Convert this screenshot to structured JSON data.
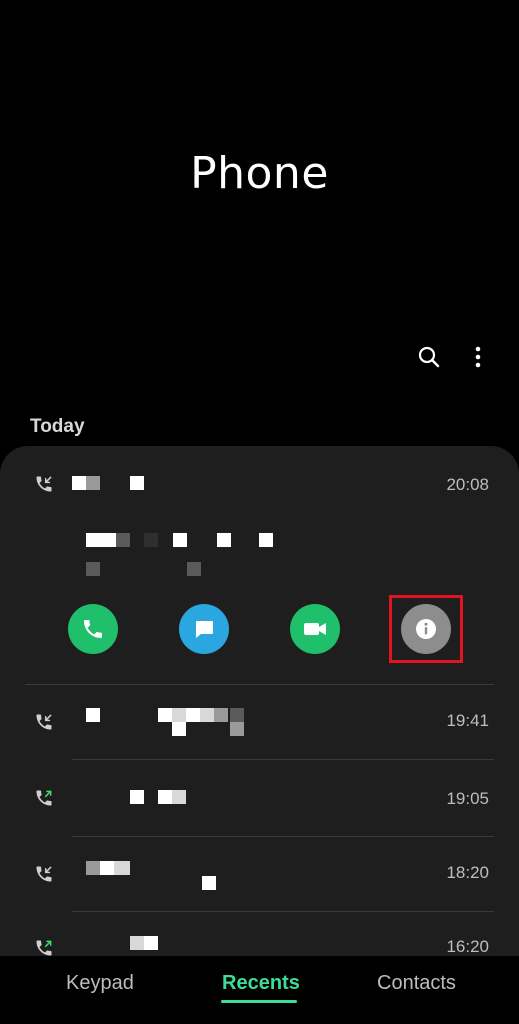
{
  "header": {
    "title": "Phone"
  },
  "toolbar": {
    "search_icon": "search-icon",
    "more_icon": "more-vertical-icon"
  },
  "section": {
    "today_label": "Today"
  },
  "calls": [
    {
      "type": "incoming",
      "time": "20:08",
      "expanded": true
    },
    {
      "type": "incoming",
      "time": "19:41"
    },
    {
      "type": "outgoing",
      "time": "19:05"
    },
    {
      "type": "incoming",
      "time": "18:20"
    },
    {
      "type": "outgoing",
      "time": "16:20"
    }
  ],
  "actions": [
    {
      "name": "voice-call",
      "icon": "phone-icon",
      "color": "#1fbf6b"
    },
    {
      "name": "message",
      "icon": "message-icon",
      "color": "#2aa7e0"
    },
    {
      "name": "video-call",
      "icon": "video-icon",
      "color": "#1fbf6b"
    },
    {
      "name": "details",
      "icon": "info-icon",
      "color": "#8d8d8d"
    }
  ],
  "nav": {
    "keypad": "Keypad",
    "recents": "Recents",
    "contacts": "Contacts",
    "active": "recents",
    "accent": "#3ddc97"
  }
}
